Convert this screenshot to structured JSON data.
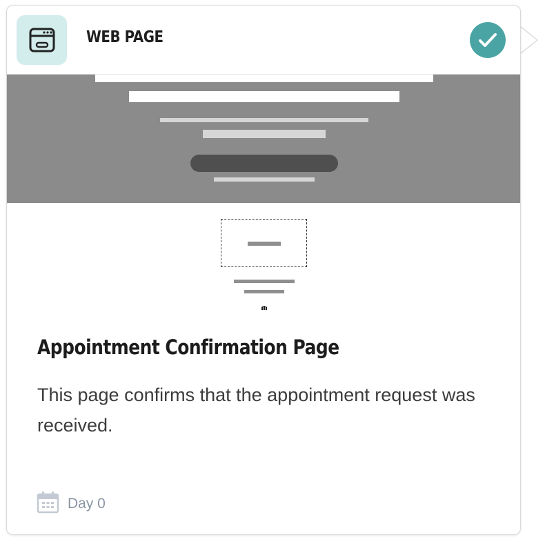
{
  "card": {
    "type_label": "WEB PAGE",
    "type_icon": "browser-window-icon",
    "status_icon": "check-icon",
    "status_color": "#4aa4a4",
    "title": "Appointment Confirmation Page",
    "description": "This page confirms that the appointment request was received.",
    "schedule_icon": "calendar-icon",
    "schedule_label": "Day 0"
  }
}
